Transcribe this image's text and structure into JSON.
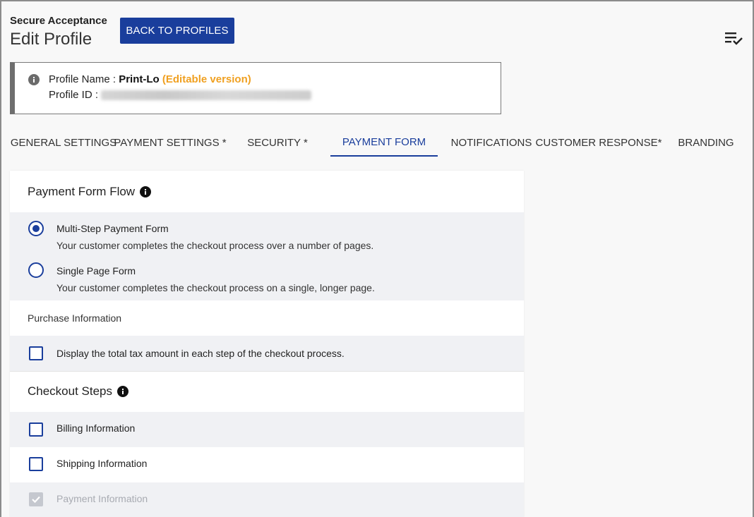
{
  "header": {
    "app_name": "Secure Acceptance",
    "page_title": "Edit Profile",
    "back_button": "BACK TO PROFILES"
  },
  "profile": {
    "name_label": "Profile Name :",
    "name_value": "Print-Lo",
    "editable_tag": "(Editable version)",
    "id_label": "Profile ID :"
  },
  "tabs": [
    {
      "label": "GENERAL SETTINGS"
    },
    {
      "label": "PAYMENT SETTINGS *"
    },
    {
      "label": "SECURITY *"
    },
    {
      "label": "PAYMENT FORM"
    },
    {
      "label": "NOTIFICATIONS"
    },
    {
      "label": "CUSTOMER RESPONSE*"
    },
    {
      "label": "BRANDING"
    }
  ],
  "active_tab": "PAYMENT FORM",
  "payment_form_flow": {
    "title": "Payment Form Flow",
    "options": [
      {
        "label": "Multi-Step Payment Form",
        "description": "Your customer completes the checkout process over a number of pages.",
        "selected": true
      },
      {
        "label": "Single Page Form",
        "description": "Your customer completes the checkout process on a single, longer page.",
        "selected": false
      }
    ]
  },
  "purchase_information": {
    "title": "Purchase Information",
    "tax_checkbox": {
      "label": "Display the total tax amount in each step of the checkout process.",
      "checked": false
    }
  },
  "checkout_steps": {
    "title": "Checkout Steps",
    "items": [
      {
        "label": "Billing Information",
        "checked": false,
        "disabled": false
      },
      {
        "label": "Shipping Information",
        "checked": false,
        "disabled": false
      },
      {
        "label": "Payment Information",
        "checked": true,
        "disabled": true
      }
    ]
  },
  "colors": {
    "primary": "#1a3e9c",
    "editable": "#f0a020",
    "shade": "#f0f1f4"
  },
  "icons": [
    "menu-check-icon",
    "info-icon",
    "radio-icon",
    "checkbox-icon"
  ]
}
